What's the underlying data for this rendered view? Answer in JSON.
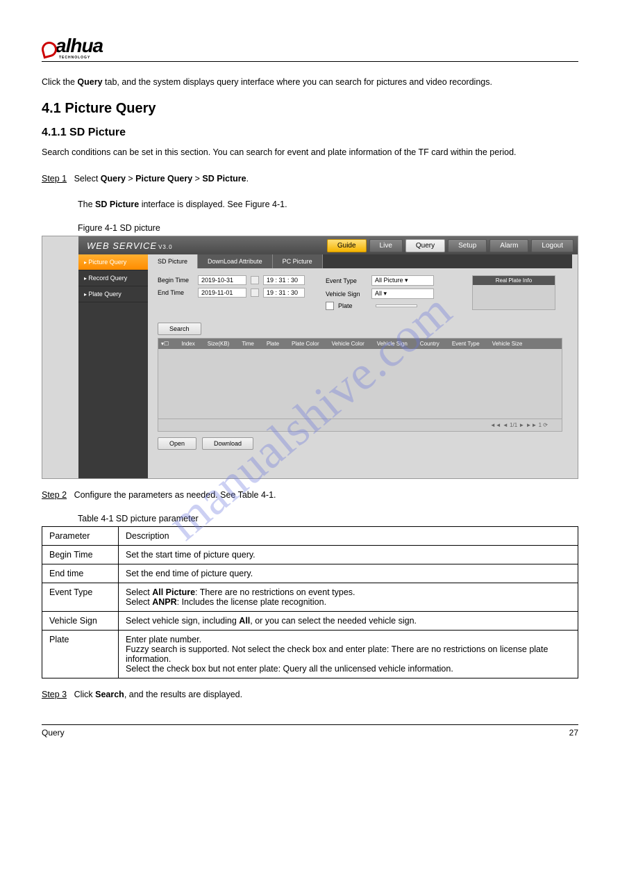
{
  "logo": {
    "brand": "alhua",
    "sub": "TECHNOLOGY"
  },
  "watermark": "manualshive.com",
  "section": {
    "num": "4.1",
    "title": "Picture Query",
    "sub_num": "4.1.1",
    "sub_title": "SD Picture",
    "intro": "Search conditions can be set in this section. You can search for event and plate information of the TF card within the period."
  },
  "steps": {
    "s1_pre": "Select ",
    "s1_b1": "Query",
    "s1_mid": " > ",
    "s1_b2": "Picture Query",
    "s1_mid2": " > ",
    "s1_b3": "SD Picture",
    "s1_post": ".",
    "s1_res_pre": "The ",
    "s1_res_b": "SD Picture",
    "s1_res_post": " interface is displayed. See Figure 4-1.",
    "s2_text": "Configure the parameters as needed. See Table 4-1.",
    "s3_pre": "Click ",
    "s3_b": "Search",
    "s3_post": ", and the results are displayed."
  },
  "labels": {
    "step1": "Step 1",
    "step2": "Step 2",
    "step3": "Step 3"
  },
  "fig_label": "Figure 4-1 SD picture",
  "tbl_label": "Table 4-1 SD picture parameter",
  "shot": {
    "title": "WEB  SERVICE",
    "ver": "V3.0",
    "nav": {
      "guide": "Guide",
      "live": "Live",
      "query": "Query",
      "setup": "Setup",
      "alarm": "Alarm",
      "logout": "Logout"
    },
    "side": {
      "picture": "Picture Query",
      "record": "Record Query",
      "plate": "Plate Query"
    },
    "tabs": {
      "sd": "SD Picture",
      "dl": "DownLoad Attribute",
      "pc": "PC Picture"
    },
    "form": {
      "begin": "Begin Time",
      "end": "End Time",
      "begin_date": "2019-10-31",
      "end_date": "2019-11-01",
      "begin_t": "19 : 31 : 30",
      "end_t": "19 : 31 : 30",
      "event": "Event Type",
      "event_v": "All Picture",
      "sign": "Vehicle Sign",
      "sign_v": "All",
      "plate": "Plate"
    },
    "plate_panel": "Real Plate Info",
    "search": "Search",
    "cols": {
      "idx": "Index",
      "size": "Size(KB)",
      "time": "Time",
      "plate": "Plate",
      "pcolor": "Plate Color",
      "vcolor": "Vehicle Color",
      "vsign": "Vehicle Sign",
      "country": "Country",
      "etype": "Event Type",
      "vsize": "Vehicle Size"
    },
    "pager": "◄◄ ◄ 1/1 ► ►►  1  ⟳",
    "open": "Open",
    "download": "Download"
  },
  "table": {
    "h_param": "Parameter",
    "h_desc": "Description",
    "r1p": "Begin Time",
    "r1d": "Set the start time of picture query.",
    "r2p": "End time",
    "r2d": "Set the end time of picture query.",
    "r3p": "Event Type",
    "r3d1_pre": "Select ",
    "r3d1_b": "All Picture",
    "r3d1_post": ": There are no restrictions on event types.",
    "r3d2_pre": "Select ",
    "r3d2_b": "ANPR",
    "r3d2_post": ": Includes the license plate recognition.",
    "r4p": "Vehicle Sign",
    "r4d_pre": "Select vehicle sign, including ",
    "r4d_b": "All",
    "r4d_post": ", or you can select the needed vehicle sign.",
    "r5p": "Plate",
    "r5d1": "Enter plate number.",
    "r5d2": "Fuzzy search is supported. Not select the check box and enter plate: There are no restrictions on license plate information.",
    "r5d3": "Select the check box but not enter plate: Query all the unlicensed vehicle information."
  },
  "footer": {
    "left": "Query",
    "right": "27"
  }
}
